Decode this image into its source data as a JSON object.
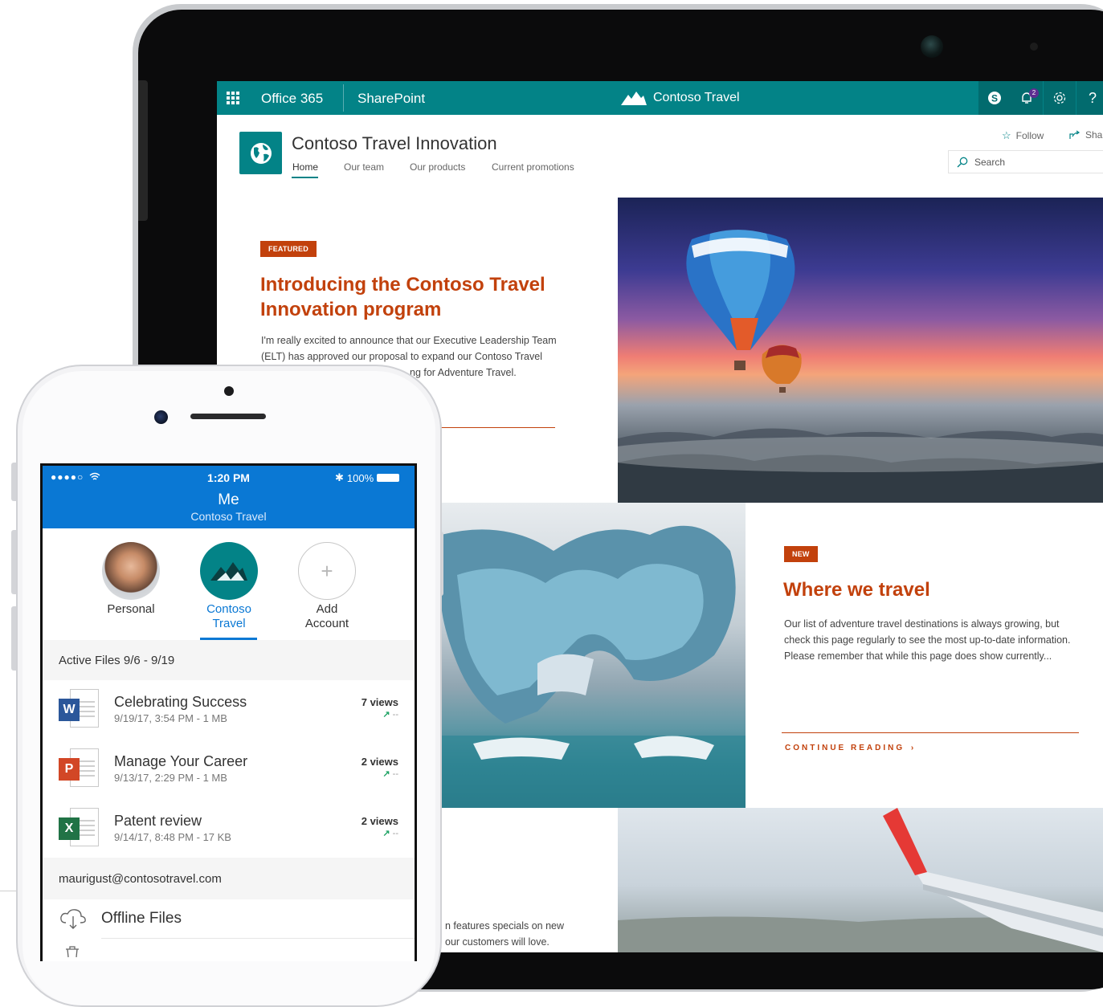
{
  "suite_bar": {
    "app_launcher_icon": "waffle-icon",
    "product": "Office 365",
    "app": "SharePoint",
    "site_brand": "Contoso Travel",
    "icons": [
      "skype-icon",
      "bell-icon",
      "gear-icon",
      "help-icon"
    ],
    "notification_count": "2",
    "help_label": "?",
    "accent_color": "#038387"
  },
  "site": {
    "title": "Contoso Travel Innovation",
    "nav": [
      "Home",
      "Our team",
      "Our products",
      "Current promotions"
    ],
    "follow_label": "Follow",
    "share_label": "Shar",
    "search_placeholder": "Search"
  },
  "articles": {
    "featured": {
      "tag": "FEATURED",
      "title": "Introducing the Contoso Travel Innovation program",
      "body_line1": "I'm really excited to announce that our Executive Leadership Team",
      "body_line2": "(ELT) has approved our proposal to expand our Contoso Travel",
      "body_line3": "ng for Adventure Travel."
    },
    "where": {
      "tag": "NEW",
      "title": "Where we travel",
      "body_line1": "Our list of adventure travel destinations is always growing, but",
      "body_line2": "check this page regularly to see the most up-to-date information.",
      "body_line3": "Please remember that while this page does show currently...",
      "cta": "CONTINUE READING",
      "cta_icon": "chevron-right-icon"
    },
    "specials": {
      "body_line1": "n features specials on new",
      "body_line2": "our customers will love."
    },
    "accent_color": "#c2410c"
  },
  "phone": {
    "status": {
      "signal": "●●●●○",
      "time": "1:20 PM",
      "bluetooth": "✱",
      "battery": "100%"
    },
    "header": {
      "title": "Me",
      "subtitle": "Contoso Travel",
      "color": "#0a78d4"
    },
    "accounts": [
      {
        "label": "Personal"
      },
      {
        "label_line1": "Contoso",
        "label_line2": "Travel"
      },
      {
        "label_line1": "Add",
        "label_line2": "Account"
      }
    ],
    "active_files_header": "Active Files 9/6 - 9/19",
    "files": [
      {
        "name": "Celebrating Success",
        "meta": "9/19/17, 3:54 PM - 1 MB",
        "views": "7 views",
        "trend": "--",
        "type": "W"
      },
      {
        "name": "Manage Your Career",
        "meta": "9/13/17, 2:29 PM - 1 MB",
        "views": "2 views",
        "trend": "--",
        "type": "P"
      },
      {
        "name": "Patent review",
        "meta": "9/14/17, 8:48 PM - 17 KB",
        "views": "2 views",
        "trend": "--",
        "type": "X"
      }
    ],
    "account_email": "maurigust@contosotravel.com",
    "offline_files": "Offline Files"
  }
}
